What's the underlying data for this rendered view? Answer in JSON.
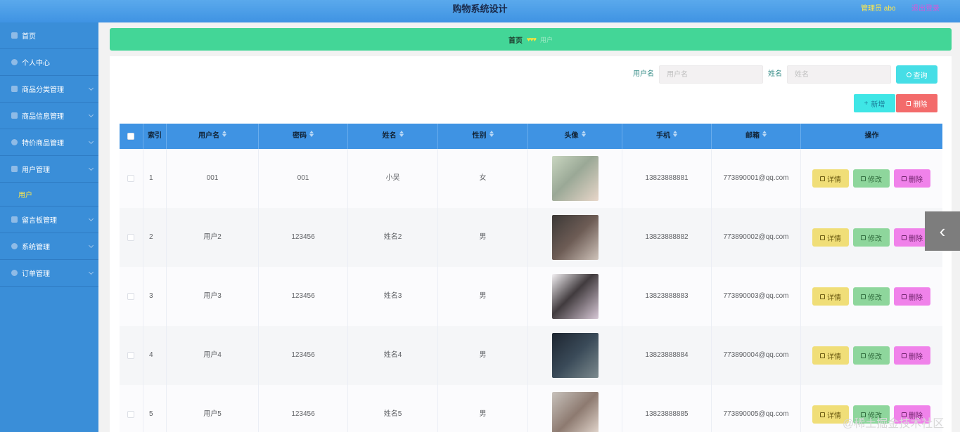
{
  "header": {
    "title": "购物系统设计",
    "admin": "管理员 abo",
    "logout": "退出登录"
  },
  "sidebar": {
    "items": [
      {
        "label": "首页",
        "icon": "home-icon"
      },
      {
        "label": "个人中心",
        "icon": "user-icon"
      },
      {
        "label": "商品分类管理",
        "icon": "category-icon"
      },
      {
        "label": "商品信息管理",
        "icon": "list-icon"
      },
      {
        "label": "特价商品管理",
        "icon": "tag-icon"
      },
      {
        "label": "用户管理",
        "icon": "send-icon"
      },
      {
        "label": "留言板管理",
        "icon": "message-icon"
      },
      {
        "label": "系统管理",
        "icon": "settings-icon"
      },
      {
        "label": "订单管理",
        "icon": "order-icon"
      }
    ],
    "active_sub": "用户"
  },
  "breadcrumb": {
    "home": "首页",
    "hearts": "♥♥♥",
    "current": "用户"
  },
  "search": {
    "username_label": "用户名",
    "username_placeholder": "用户名",
    "name_label": "姓名",
    "name_placeholder": "姓名",
    "query_button": "查询"
  },
  "actions": {
    "add": "新增",
    "delete": "删除"
  },
  "table": {
    "headers": [
      "索引",
      "用户名",
      "密码",
      "姓名",
      "性别",
      "头像",
      "手机",
      "邮箱",
      "操作"
    ],
    "rows": [
      {
        "index": "1",
        "username": "001",
        "password": "001",
        "name": "小吴",
        "gender": "女",
        "phone": "13823888881",
        "email": "773890001@qq.com"
      },
      {
        "index": "2",
        "username": "用户2",
        "password": "123456",
        "name": "姓名2",
        "gender": "男",
        "phone": "13823888882",
        "email": "773890002@qq.com"
      },
      {
        "index": "3",
        "username": "用户3",
        "password": "123456",
        "name": "姓名3",
        "gender": "男",
        "phone": "13823888883",
        "email": "773890003@qq.com"
      },
      {
        "index": "4",
        "username": "用户4",
        "password": "123456",
        "name": "姓名4",
        "gender": "男",
        "phone": "13823888884",
        "email": "773890004@qq.com"
      },
      {
        "index": "5",
        "username": "用户5",
        "password": "123456",
        "name": "姓名5",
        "gender": "男",
        "phone": "13823888885",
        "email": "773890005@qq.com"
      }
    ],
    "row_actions": {
      "detail": "详情",
      "edit": "修改",
      "remove": "删除"
    }
  },
  "watermark": "@稀土掘金技术社区"
}
